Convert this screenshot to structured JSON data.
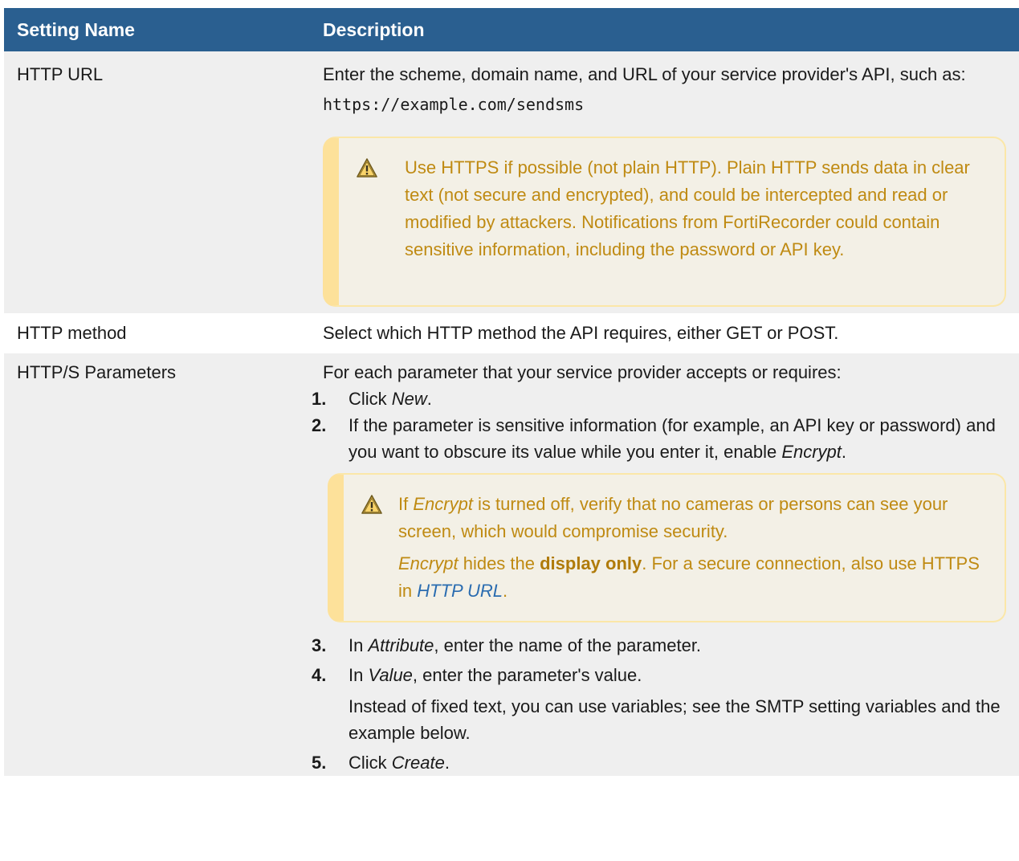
{
  "table": {
    "headers": [
      "Setting Name",
      "Description"
    ],
    "rows": {
      "http_url": {
        "name": "HTTP URL",
        "desc_line": "Enter the scheme, domain name, and URL of your service provider's API, such as:",
        "example": "https://example.com/sendsms",
        "note": "Use HTTPS if possible (not plain HTTP). Plain HTTP sends data in clear text (not secure and encrypted), and could be intercepted and read or modified by attackers. Notifications from FortiRecorder could contain sensitive information, including the password or API key."
      },
      "http_method": {
        "name": "HTTP method",
        "desc": "Select which HTTP method the API requires, either GET or POST."
      },
      "params": {
        "name": "HTTP/S Parameters",
        "intro": "For each parameter that your service provider accepts or requires:",
        "step1_num": "1.",
        "step1_a": "Click ",
        "step1_em": "New",
        "step1_b": ".",
        "step2_num": "2.",
        "step2_a": "If the parameter is sensitive information (for example, an API key or password) and you want to obscure its value while you enter it, enable ",
        "step2_em": "Encrypt",
        "step2_b": ".",
        "note_a": "If ",
        "note_em1": "Encrypt",
        "note_b": " is turned off, verify that no cameras or persons can see your screen, which would compromise security.",
        "note_em2": "Encrypt",
        "note_c": " hides the ",
        "note_bold": "display only",
        "note_d": ". For a secure connection, also use HTTPS in ",
        "note_link": "HTTP URL",
        "note_e": ".",
        "step3_num": "3.",
        "step3_a": "In ",
        "step3_em": "Attribute",
        "step3_b": ", enter the name of the parameter.",
        "step4_num": "4.",
        "step4_a": "In ",
        "step4_em": "Value",
        "step4_b": ", enter the parameter's value.",
        "step4_sub": "Instead of fixed text, you can use variables; see the SMTP setting variables and the example below.",
        "step5_num": "5.",
        "step5_a": "Click ",
        "step5_em": "Create",
        "step5_b": "."
      }
    }
  },
  "colors": {
    "header_bg": "#2a5f90",
    "note_text": "#bf8a12",
    "note_border": "#fde19a",
    "link": "#2a6cb0"
  },
  "icons": [
    "warning-icon"
  ]
}
